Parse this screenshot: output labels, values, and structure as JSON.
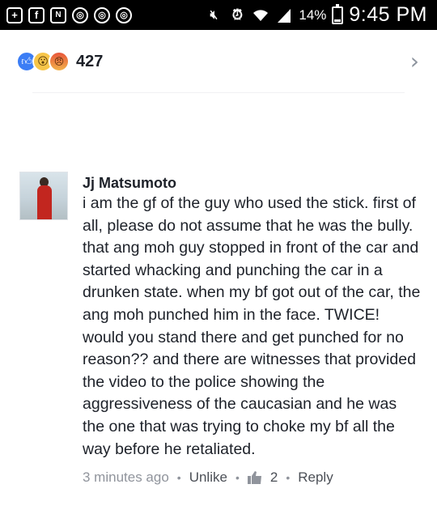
{
  "status_bar": {
    "left_icons": [
      "plus-icon",
      "facebook-icon",
      "nfc-icon",
      "instagram-icon",
      "instagram-icon",
      "instagram-icon"
    ],
    "right_icons": [
      "mute-icon",
      "alarm-icon",
      "wifi-icon",
      "signal-icon",
      "battery-icon"
    ],
    "battery_percent": "14%",
    "time": "9:45 PM",
    "colors": {
      "background": "#000000",
      "foreground": "#ffffff"
    }
  },
  "reactions": {
    "types": [
      "like",
      "wow",
      "angry"
    ],
    "count": "427"
  },
  "comment": {
    "author": "Jj Matsumoto",
    "text": "i am the gf of the guy who used the stick. first of all, please do not assume that he was the bully. that ang moh guy stopped in front of the car and started whacking and punching the car in a drunken state. when my bf got out of the car, the ang moh punched him in the face. TWICE! would you stand there and get punched for no reason?? and there are witnesses that provided the video to the police showing the aggressiveness of the caucasian and he was the one that was trying to choke my bf all the way before he retaliated.",
    "timestamp": "3 minutes ago",
    "unlike_label": "Unlike",
    "like_count": "2",
    "reply_label": "Reply",
    "separator": "•"
  },
  "colors": {
    "text": "#1d2129",
    "meta": "#90949c",
    "like_blue": "#3b7df5"
  }
}
